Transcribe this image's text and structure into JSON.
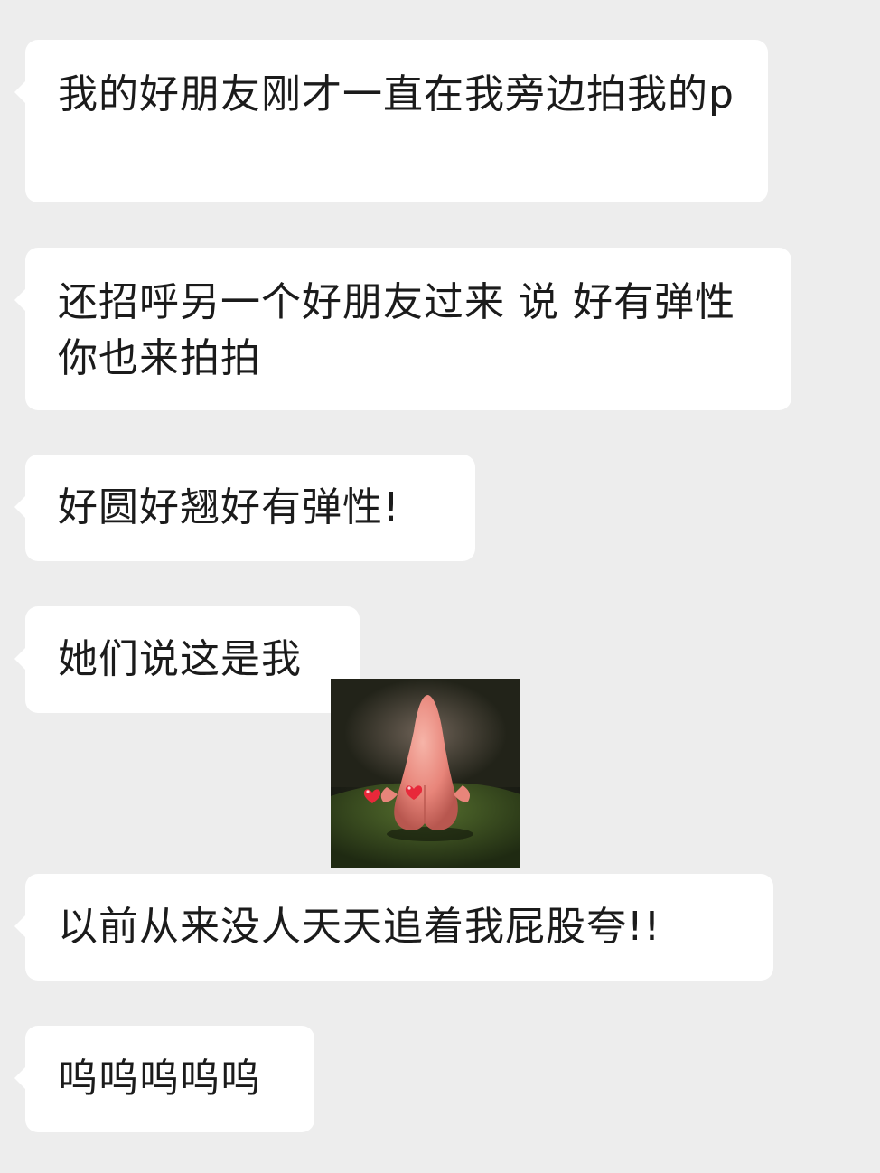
{
  "messages": [
    {
      "text": "我的好朋友刚才一直在我旁边拍我的p"
    },
    {
      "text": "还招呼另一个好朋友过来 说 好有弹性 你也来拍拍"
    },
    {
      "text": "好圆好翘好有弹性!"
    },
    {
      "text": "她们说这是我"
    },
    {
      "text": "以前从来没人天天追着我屁股夸!!"
    },
    {
      "text": "呜呜呜呜呜"
    }
  ],
  "sticker": {
    "subject": "pink-starfish-character-back-view-with-hearts",
    "colors": {
      "body": "#e8857a",
      "highlight": "#f6b4a8",
      "ground": "#3e5a24",
      "heart": "#e8283a"
    }
  },
  "colors": {
    "background": "#ededed",
    "bubble": "#ffffff",
    "text": "#1b1b1b"
  }
}
